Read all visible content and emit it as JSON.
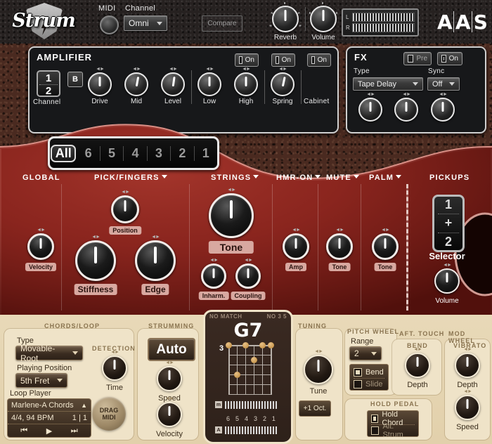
{
  "app": {
    "logo_text": "Strum",
    "brand": "A A S"
  },
  "topbar": {
    "midi_label": "MIDI",
    "channel_label": "Channel",
    "channel_value": "Omni",
    "compare_label": "Compare",
    "reverb_label": "Reverb",
    "volume_label": "Volume",
    "meter_left": "L",
    "meter_right": "R"
  },
  "amplifier": {
    "title": "AMPLIFIER",
    "channel_label": "Channel",
    "channel_top": "1",
    "channel_bottom": "2",
    "b_button": "B",
    "knobs": [
      {
        "label": "Drive",
        "angle": -3
      },
      {
        "label": "Mid",
        "angle": 12
      },
      {
        "label": "Level",
        "angle": 8
      },
      {
        "label": "Low",
        "angle": 5
      },
      {
        "label": "High",
        "angle": 2
      },
      {
        "label": "Spring",
        "angle": 10
      }
    ],
    "spring_on": "On",
    "cabinet_on": "On",
    "reverb_on": "On",
    "cabinet_label": "Cabinet"
  },
  "fx": {
    "title": "FX",
    "pre_label": "Pre",
    "on_label": "On",
    "type_label": "Type",
    "type_value": "Tape Delay",
    "sync_label": "Sync",
    "sync_value": "Off"
  },
  "string_selector": {
    "items": [
      "All",
      "6",
      "5",
      "4",
      "3",
      "2",
      "1"
    ],
    "active": "All"
  },
  "guitar_sections": [
    {
      "title": "GLOBAL",
      "caret": false
    },
    {
      "title": "PICK/FINGERS",
      "caret": true
    },
    {
      "title": "STRINGS",
      "caret": true
    },
    {
      "title": "HMR-ON",
      "caret": true
    },
    {
      "title": "MUTE",
      "caret": true
    },
    {
      "title": "PALM",
      "caret": true
    },
    {
      "title": "PICKUPS",
      "caret": false
    }
  ],
  "guitar_knobs": {
    "velocity": "Velocity",
    "position": "Position",
    "stiffness": "Stiffness",
    "edge": "Edge",
    "strings_tone": "Tone",
    "inharm": "Inharm.",
    "coupling": "Coupling",
    "hmr_amp": "Amp",
    "mute_tone": "Tone",
    "palm_tone": "Tone",
    "pickup_volume": "Volume"
  },
  "pickups": {
    "selector_label": "Selector",
    "sel_top": "1",
    "sel_mid": "+",
    "sel_bottom": "2"
  },
  "chords_loop": {
    "title": "CHORDS/LOOP",
    "type_label": "Type",
    "type_value": "Movable-Root",
    "position_label": "Playing Position",
    "position_value": "5th Fret",
    "loop_label": "Loop Player",
    "loop_name": "Marlene-A Chords",
    "loop_meter": "4/4, 94 BPM",
    "loop_bars": "1 | 1",
    "drag_midi_line1": "DRAG",
    "drag_midi_line2": "MIDI",
    "detection_title": "DETECTION",
    "detection_knob": "Time"
  },
  "strumming": {
    "title": "STRUMMING",
    "auto_label": "Auto",
    "speed_label": "Speed",
    "velocity_label": "Velocity"
  },
  "chord_display": {
    "no_match": "NO MATCH",
    "no_chord": "NO 3 5",
    "chord_name": "G7",
    "start_fret": "3",
    "string_numbers": [
      "6",
      "5",
      "4",
      "3",
      "2",
      "1"
    ],
    "meter_m": "m",
    "meter_a": "A"
  },
  "tuning": {
    "title": "TUNING",
    "knob_label": "Tune",
    "oct_button": "+1 Oct."
  },
  "pitch_wheel": {
    "title": "PITCH WHEEL",
    "range_label": "Range",
    "range_value": "2",
    "bend_label": "Bend",
    "slide_label": "Slide"
  },
  "hold_pedal": {
    "title": "HOLD PEDAL",
    "hold_chord_label": "Hold Chord",
    "alt_strum_label": "Alt. Strum"
  },
  "aftertouch": {
    "title": "AFT. TOUCH",
    "sub_title": "BEND",
    "depth_label": "Depth"
  },
  "mod_wheel": {
    "title": "MOD WHEEL",
    "sub_title": "VIBRATO",
    "depth_label": "Depth",
    "speed_label": "Speed"
  },
  "colors": {
    "body_red": "#86231d",
    "cream": "#e8d9b8",
    "panel_bg": "#17181a",
    "pill": "#d8a8a0"
  },
  "chart_data": null
}
